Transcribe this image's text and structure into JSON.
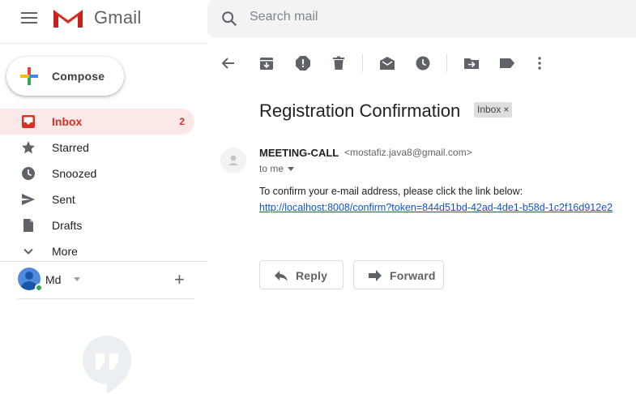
{
  "app": {
    "name": "Gmail"
  },
  "search": {
    "placeholder": "Search mail"
  },
  "compose": {
    "label": "Compose"
  },
  "sidebar": {
    "items": [
      {
        "label": "Inbox",
        "count": "2",
        "icon": "inbox-icon",
        "active": true
      },
      {
        "label": "Starred",
        "icon": "star-icon"
      },
      {
        "label": "Snoozed",
        "icon": "clock-icon"
      },
      {
        "label": "Sent",
        "icon": "send-icon"
      },
      {
        "label": "Drafts",
        "icon": "draft-icon"
      },
      {
        "label": "More",
        "icon": "chevron-down-icon"
      }
    ]
  },
  "account": {
    "name": "Md",
    "status": "online"
  },
  "toolbar": {
    "icons": [
      "back-arrow-icon",
      "archive-icon",
      "report-spam-icon",
      "delete-icon",
      "mark-unread-icon",
      "snooze-icon",
      "move-to-icon",
      "labels-icon",
      "more-vert-icon"
    ]
  },
  "message": {
    "subject": "Registration Confirmation",
    "label": "Inbox",
    "label_close": "×",
    "sender_name": "MEETING-CALL",
    "sender_email": "<mostafiz.java8@gmail.com>",
    "recipient": "to me",
    "body_text": "To confirm your e-mail address, please click the link below:",
    "link": "http://localhost:8008/confirm?token=844d51bd-42ad-4de1-b58d-1c2f16d912e2"
  },
  "actions": {
    "reply": "Reply",
    "forward": "Forward"
  },
  "colors": {
    "accent_red": "#d93025",
    "active_bg": "#fce8e6",
    "link": "#1155cc"
  }
}
